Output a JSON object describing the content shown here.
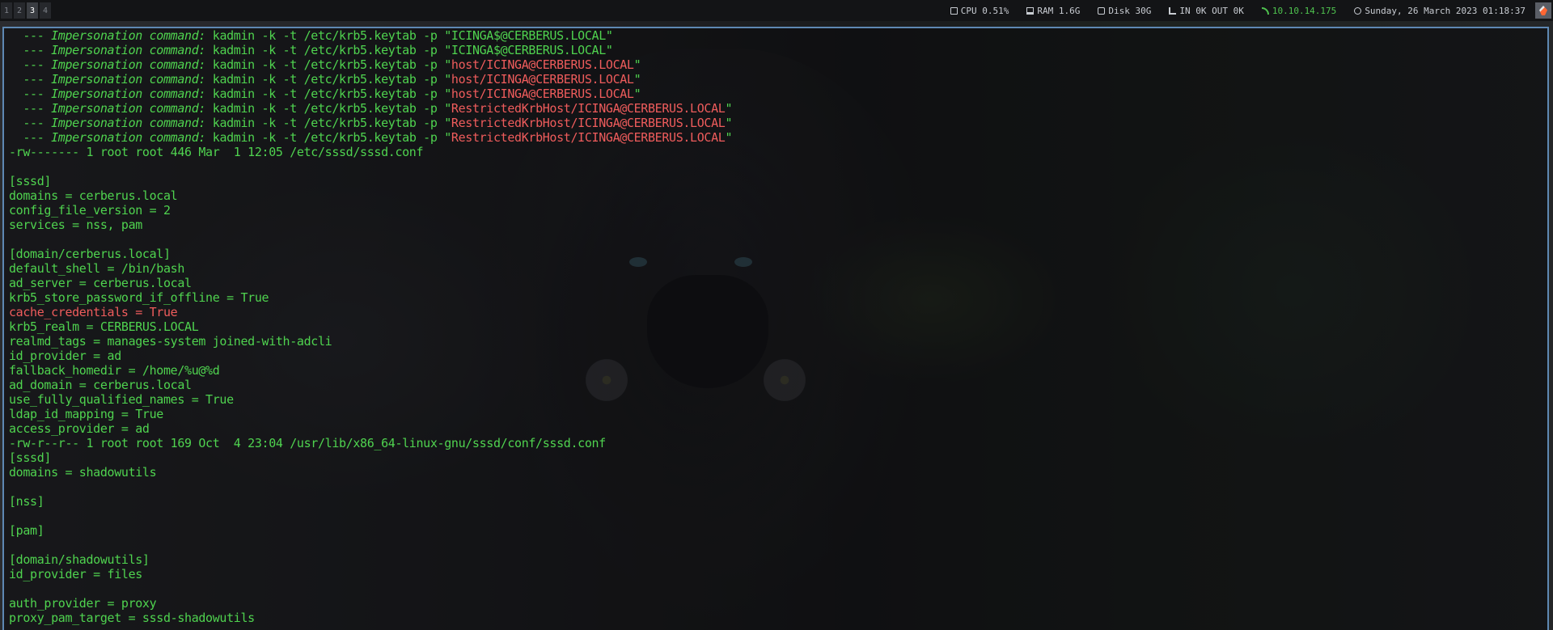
{
  "topbar": {
    "workspaces": [
      {
        "label": "1",
        "active": false
      },
      {
        "label": "2",
        "active": false
      },
      {
        "label": "3",
        "active": true
      },
      {
        "label": "4",
        "active": false
      }
    ],
    "cpu": "CPU 0.51%",
    "ram": "RAM 1.6G",
    "disk": "Disk 30G",
    "network": "IN 0K OUT 0K",
    "vpn_ip": "10.10.14.175",
    "datetime": "Sunday, 26 March 2023 01:18:37",
    "icons": {
      "cpu": "cpu-icon",
      "ram": "ram-icon",
      "disk": "disk-icon",
      "network": "network-icon",
      "vpn": "vpn-icon",
      "clock": "clock-icon",
      "launcher": "burpsuite-icon"
    }
  },
  "colors": {
    "text_green": "#4fd34f",
    "text_red": "#ef5c5c",
    "window_border": "#5e88b3",
    "vpn_green": "#4fc34f"
  },
  "terminal": {
    "lines": [
      {
        "segments": [
          {
            "text": "  --- ",
            "style": "green"
          },
          {
            "text": "Impersonation command:",
            "style": "italic"
          },
          {
            "text": " kadmin -k -t /etc/krb5.keytab -p \"",
            "style": "green"
          },
          {
            "text": "ICINGA$@CERBERUS.LOCAL",
            "style": "green"
          },
          {
            "text": "\"",
            "style": "green"
          }
        ]
      },
      {
        "segments": [
          {
            "text": "  --- ",
            "style": "green"
          },
          {
            "text": "Impersonation command:",
            "style": "italic"
          },
          {
            "text": " kadmin -k -t /etc/krb5.keytab -p \"",
            "style": "green"
          },
          {
            "text": "ICINGA$@CERBERUS.LOCAL",
            "style": "green"
          },
          {
            "text": "\"",
            "style": "green"
          }
        ]
      },
      {
        "segments": [
          {
            "text": "  --- ",
            "style": "green"
          },
          {
            "text": "Impersonation command:",
            "style": "italic"
          },
          {
            "text": " kadmin -k -t /etc/krb5.keytab -p \"",
            "style": "green"
          },
          {
            "text": "host/ICINGA@CERBERUS.LOCAL",
            "style": "red"
          },
          {
            "text": "\"",
            "style": "green"
          }
        ]
      },
      {
        "segments": [
          {
            "text": "  --- ",
            "style": "green"
          },
          {
            "text": "Impersonation command:",
            "style": "italic"
          },
          {
            "text": " kadmin -k -t /etc/krb5.keytab -p \"",
            "style": "green"
          },
          {
            "text": "host/ICINGA@CERBERUS.LOCAL",
            "style": "red"
          },
          {
            "text": "\"",
            "style": "green"
          }
        ]
      },
      {
        "segments": [
          {
            "text": "  --- ",
            "style": "green"
          },
          {
            "text": "Impersonation command:",
            "style": "italic"
          },
          {
            "text": " kadmin -k -t /etc/krb5.keytab -p \"",
            "style": "green"
          },
          {
            "text": "host/ICINGA@CERBERUS.LOCAL",
            "style": "red"
          },
          {
            "text": "\"",
            "style": "green"
          }
        ]
      },
      {
        "segments": [
          {
            "text": "  --- ",
            "style": "green"
          },
          {
            "text": "Impersonation command:",
            "style": "italic"
          },
          {
            "text": " kadmin -k -t /etc/krb5.keytab -p \"",
            "style": "green"
          },
          {
            "text": "RestrictedKrbHost/ICINGA@CERBERUS.LOCAL",
            "style": "red"
          },
          {
            "text": "\"",
            "style": "green"
          }
        ]
      },
      {
        "segments": [
          {
            "text": "  --- ",
            "style": "green"
          },
          {
            "text": "Impersonation command:",
            "style": "italic"
          },
          {
            "text": " kadmin -k -t /etc/krb5.keytab -p \"",
            "style": "green"
          },
          {
            "text": "RestrictedKrbHost/ICINGA@CERBERUS.LOCAL",
            "style": "red"
          },
          {
            "text": "\"",
            "style": "green"
          }
        ]
      },
      {
        "segments": [
          {
            "text": "  --- ",
            "style": "green"
          },
          {
            "text": "Impersonation command:",
            "style": "italic"
          },
          {
            "text": " kadmin -k -t /etc/krb5.keytab -p \"",
            "style": "green"
          },
          {
            "text": "RestrictedKrbHost/ICINGA@CERBERUS.LOCAL",
            "style": "red"
          },
          {
            "text": "\"",
            "style": "green"
          }
        ]
      },
      {
        "segments": [
          {
            "text": "-rw------- 1 root root 446 Mar  1 12:05 /etc/sssd/sssd.conf",
            "style": "green"
          }
        ]
      },
      {
        "segments": [
          {
            "text": "",
            "style": "green"
          }
        ]
      },
      {
        "segments": [
          {
            "text": "[sssd]",
            "style": "green"
          }
        ]
      },
      {
        "segments": [
          {
            "text": "domains = cerberus.local",
            "style": "green"
          }
        ]
      },
      {
        "segments": [
          {
            "text": "config_file_version = 2",
            "style": "green"
          }
        ]
      },
      {
        "segments": [
          {
            "text": "services = nss, pam",
            "style": "green"
          }
        ]
      },
      {
        "segments": [
          {
            "text": "",
            "style": "green"
          }
        ]
      },
      {
        "segments": [
          {
            "text": "[domain/cerberus.local]",
            "style": "green"
          }
        ]
      },
      {
        "segments": [
          {
            "text": "default_shell = /bin/bash",
            "style": "green"
          }
        ]
      },
      {
        "segments": [
          {
            "text": "ad_server = cerberus.local",
            "style": "green"
          }
        ]
      },
      {
        "segments": [
          {
            "text": "krb5_store_password_if_offline = True",
            "style": "green"
          }
        ]
      },
      {
        "segments": [
          {
            "text": "cache_credentials = True",
            "style": "red"
          }
        ]
      },
      {
        "segments": [
          {
            "text": "krb5_realm = CERBERUS.LOCAL",
            "style": "green"
          }
        ]
      },
      {
        "segments": [
          {
            "text": "realmd_tags = manages-system joined-with-adcli",
            "style": "green"
          }
        ]
      },
      {
        "segments": [
          {
            "text": "id_provider = ad",
            "style": "green"
          }
        ]
      },
      {
        "segments": [
          {
            "text": "fallback_homedir = /home/%u@%d",
            "style": "green"
          }
        ]
      },
      {
        "segments": [
          {
            "text": "ad_domain = cerberus.local",
            "style": "green"
          }
        ]
      },
      {
        "segments": [
          {
            "text": "use_fully_qualified_names = True",
            "style": "green"
          }
        ]
      },
      {
        "segments": [
          {
            "text": "ldap_id_mapping = True",
            "style": "green"
          }
        ]
      },
      {
        "segments": [
          {
            "text": "access_provider = ad",
            "style": "green"
          }
        ]
      },
      {
        "segments": [
          {
            "text": "-rw-r--r-- 1 root root 169 Oct  4 23:04 /usr/lib/x86_64-linux-gnu/sssd/conf/sssd.conf",
            "style": "green"
          }
        ]
      },
      {
        "segments": [
          {
            "text": "[sssd]",
            "style": "green"
          }
        ]
      },
      {
        "segments": [
          {
            "text": "domains = shadowutils",
            "style": "green"
          }
        ]
      },
      {
        "segments": [
          {
            "text": "",
            "style": "green"
          }
        ]
      },
      {
        "segments": [
          {
            "text": "[nss]",
            "style": "green"
          }
        ]
      },
      {
        "segments": [
          {
            "text": "",
            "style": "green"
          }
        ]
      },
      {
        "segments": [
          {
            "text": "[pam]",
            "style": "green"
          }
        ]
      },
      {
        "segments": [
          {
            "text": "",
            "style": "green"
          }
        ]
      },
      {
        "segments": [
          {
            "text": "[domain/shadowutils]",
            "style": "green"
          }
        ]
      },
      {
        "segments": [
          {
            "text": "id_provider = files",
            "style": "green"
          }
        ]
      },
      {
        "segments": [
          {
            "text": "",
            "style": "green"
          }
        ]
      },
      {
        "segments": [
          {
            "text": "auth_provider = proxy",
            "style": "green"
          }
        ]
      },
      {
        "segments": [
          {
            "text": "proxy_pam_target = sssd-shadowutils",
            "style": "green"
          }
        ]
      }
    ]
  }
}
